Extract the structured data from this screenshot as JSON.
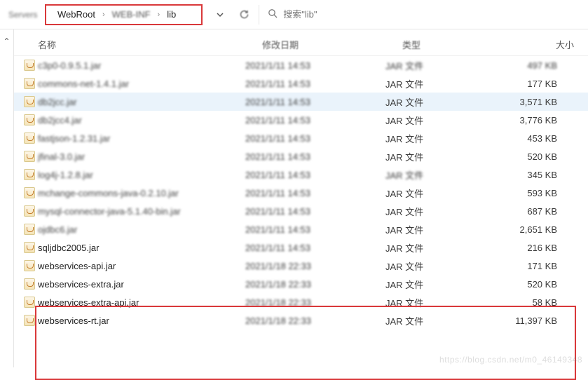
{
  "toolbar": {
    "org_label": "Servers",
    "breadcrumb": [
      "WebRoot",
      "WEB-INF",
      "lib"
    ],
    "search_placeholder": "搜索\"lib\""
  },
  "columns": {
    "name": "名称",
    "date": "修改日期",
    "type": "类型",
    "size": "大小"
  },
  "rows": [
    {
      "name": "c3p0-0.9.5.1.jar",
      "name_blur": true,
      "date": "2021/1/11 14:53",
      "type": "JAR 文件",
      "type_blur": true,
      "size": "497 KB",
      "size_blur": true
    },
    {
      "name": "commons-net-1.4.1.jar",
      "name_blur": true,
      "date": "2021/1/11 14:53",
      "type": "JAR 文件",
      "type_blur": false,
      "size": "177 KB"
    },
    {
      "name": "db2jcc.jar",
      "name_blur": true,
      "date": "2021/1/11 14:53",
      "type": "JAR 文件",
      "type_blur": false,
      "size": "3,571 KB",
      "hover": true
    },
    {
      "name": "db2jcc4.jar",
      "name_blur": true,
      "date": "2021/1/11 14:53",
      "type": "JAR 文件",
      "type_blur": false,
      "size": "3,776 KB"
    },
    {
      "name": "fastjson-1.2.31.jar",
      "name_blur": true,
      "date": "2021/1/11 14:53",
      "type": "JAR 文件",
      "type_blur": false,
      "size": "453 KB"
    },
    {
      "name": "jfinal-3.0.jar",
      "name_blur": true,
      "date": "2021/1/11 14:53",
      "type": "JAR 文件",
      "type_blur": false,
      "size": "520 KB"
    },
    {
      "name": "log4j-1.2.8.jar",
      "name_blur": true,
      "date": "2021/1/11 14:53",
      "type": "JAR 文件",
      "type_blur": true,
      "size": "345 KB"
    },
    {
      "name": "mchange-commons-java-0.2.10.jar",
      "name_blur": true,
      "date": "2021/1/11 14:53",
      "type": "JAR 文件",
      "type_blur": false,
      "size": "593 KB"
    },
    {
      "name": "mysql-connector-java-5.1.40-bin.jar",
      "name_blur": true,
      "date": "2021/1/11 14:53",
      "type": "JAR 文件",
      "type_blur": false,
      "size": "687 KB"
    },
    {
      "name": "ojdbc6.jar",
      "name_blur": true,
      "date": "2021/1/11 14:53",
      "type": "JAR 文件",
      "type_blur": false,
      "size": "2,651 KB"
    },
    {
      "name": "sqljdbc2005.jar",
      "name_blur": false,
      "date": "2021/1/11 14:53",
      "type": "JAR 文件",
      "type_blur": false,
      "size": "216 KB"
    },
    {
      "name": "webservices-api.jar",
      "name_blur": false,
      "date": "2021/1/18 22:33",
      "type": "JAR 文件",
      "type_blur": false,
      "size": "171 KB"
    },
    {
      "name": "webservices-extra.jar",
      "name_blur": false,
      "date": "2021/1/18 22:33",
      "type": "JAR 文件",
      "type_blur": false,
      "size": "520 KB"
    },
    {
      "name": "webservices-extra-api.jar",
      "name_blur": false,
      "date": "2021/1/18 22:33",
      "type": "JAR 文件",
      "type_blur": false,
      "size": "58 KB"
    },
    {
      "name": "webservices-rt.jar",
      "name_blur": false,
      "date": "2021/1/18 22:33",
      "type": "JAR 文件",
      "type_blur": false,
      "size": "11,397 KB"
    }
  ],
  "watermark": "https://blog.csdn.net/m0_46149348"
}
